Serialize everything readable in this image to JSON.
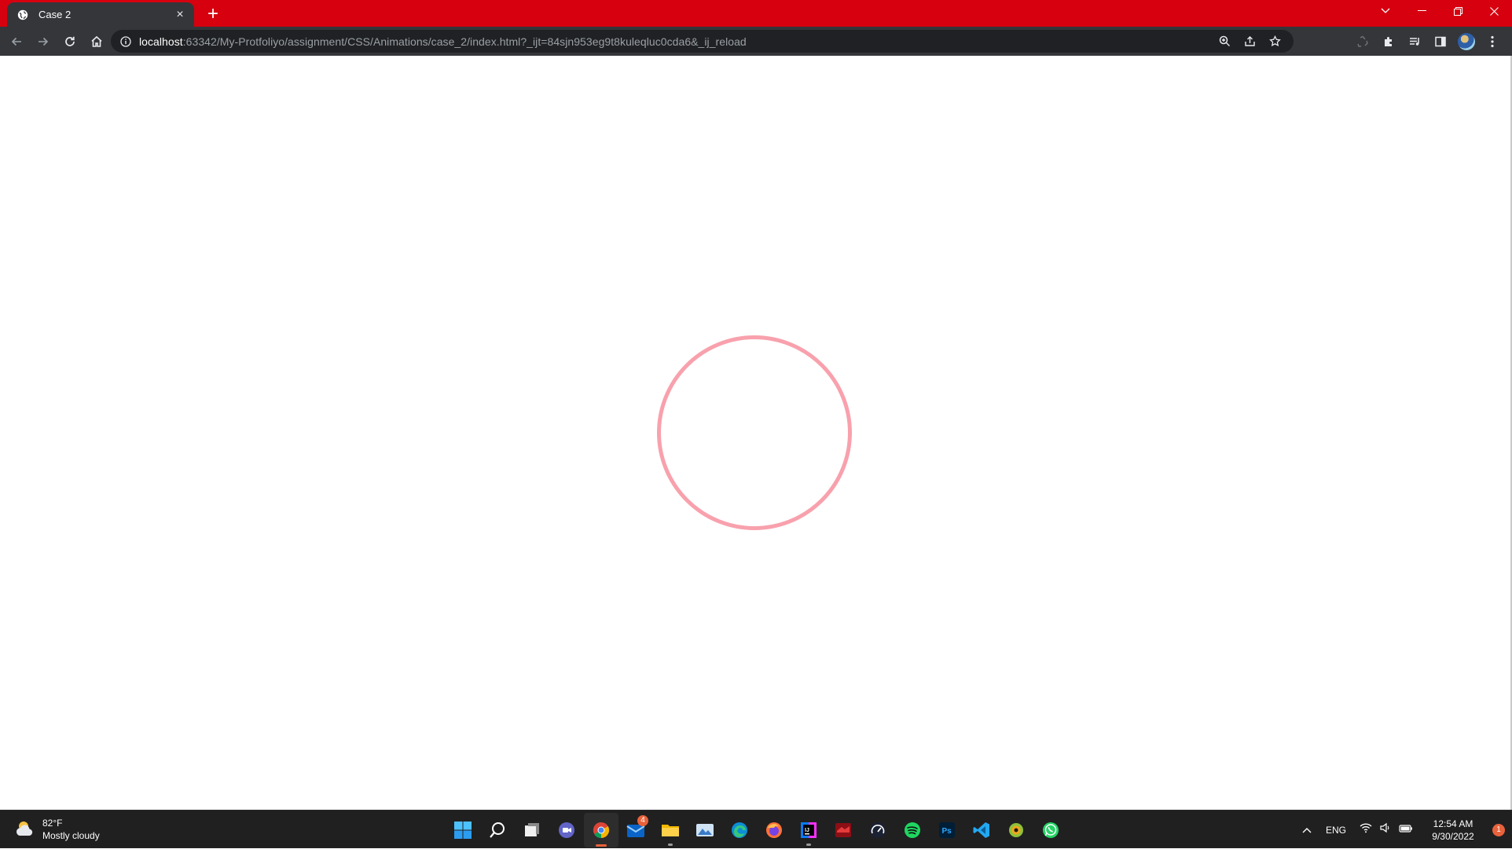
{
  "browser": {
    "tab": {
      "title": "Case 2",
      "favicon": "globe-icon",
      "close": "×"
    },
    "new_tab_label": "+",
    "omnibox": {
      "host": "localhost",
      "rest": ":63342/My-Protfoliyo/assignment/CSS/Animations/case_2/index.html?_ijt=84sjn953eg9t8kuleqluc0cda6&_ij_reload"
    },
    "toolbar_icons": [
      "back-arrow-icon",
      "forward-arrow-icon",
      "reload-icon",
      "home-icon"
    ],
    "omnibox_icons": [
      "zoom-icon",
      "share-icon",
      "bookmark-star-icon"
    ],
    "right_icons": [
      "recycle-extension-icon",
      "puzzle-extensions-icon",
      "media-queue-icon",
      "side-panel-icon",
      "profile-avatar",
      "kebab-menu-icon"
    ],
    "colors": {
      "frame": "#d6000f",
      "toolbar": "#35363a",
      "omnibox": "#202124"
    }
  },
  "page": {
    "ring_color": "#f8a1ad"
  },
  "taskbar": {
    "weather": {
      "temp": "82°F",
      "condition": "Mostly cloudy"
    },
    "apps": [
      {
        "name": "windows-start-icon"
      },
      {
        "name": "search-icon"
      },
      {
        "name": "task-view-icon"
      },
      {
        "name": "teams-chat-icon"
      },
      {
        "name": "chrome-icon",
        "active": true
      },
      {
        "name": "mail-icon",
        "badge": "4"
      },
      {
        "name": "file-explorer-icon"
      },
      {
        "name": "photos-icon"
      },
      {
        "name": "edge-icon"
      },
      {
        "name": "firefox-icon"
      },
      {
        "name": "intellij-icon"
      },
      {
        "name": "red-app-icon"
      },
      {
        "name": "speedometer-icon"
      },
      {
        "name": "spotify-icon"
      },
      {
        "name": "photoshop-icon"
      },
      {
        "name": "vscode-icon"
      },
      {
        "name": "snail-app-icon"
      },
      {
        "name": "whatsapp-icon"
      }
    ],
    "tray": {
      "lang": "ENG",
      "time": "12:54 AM",
      "date": "9/30/2022",
      "notifications": "1"
    }
  }
}
